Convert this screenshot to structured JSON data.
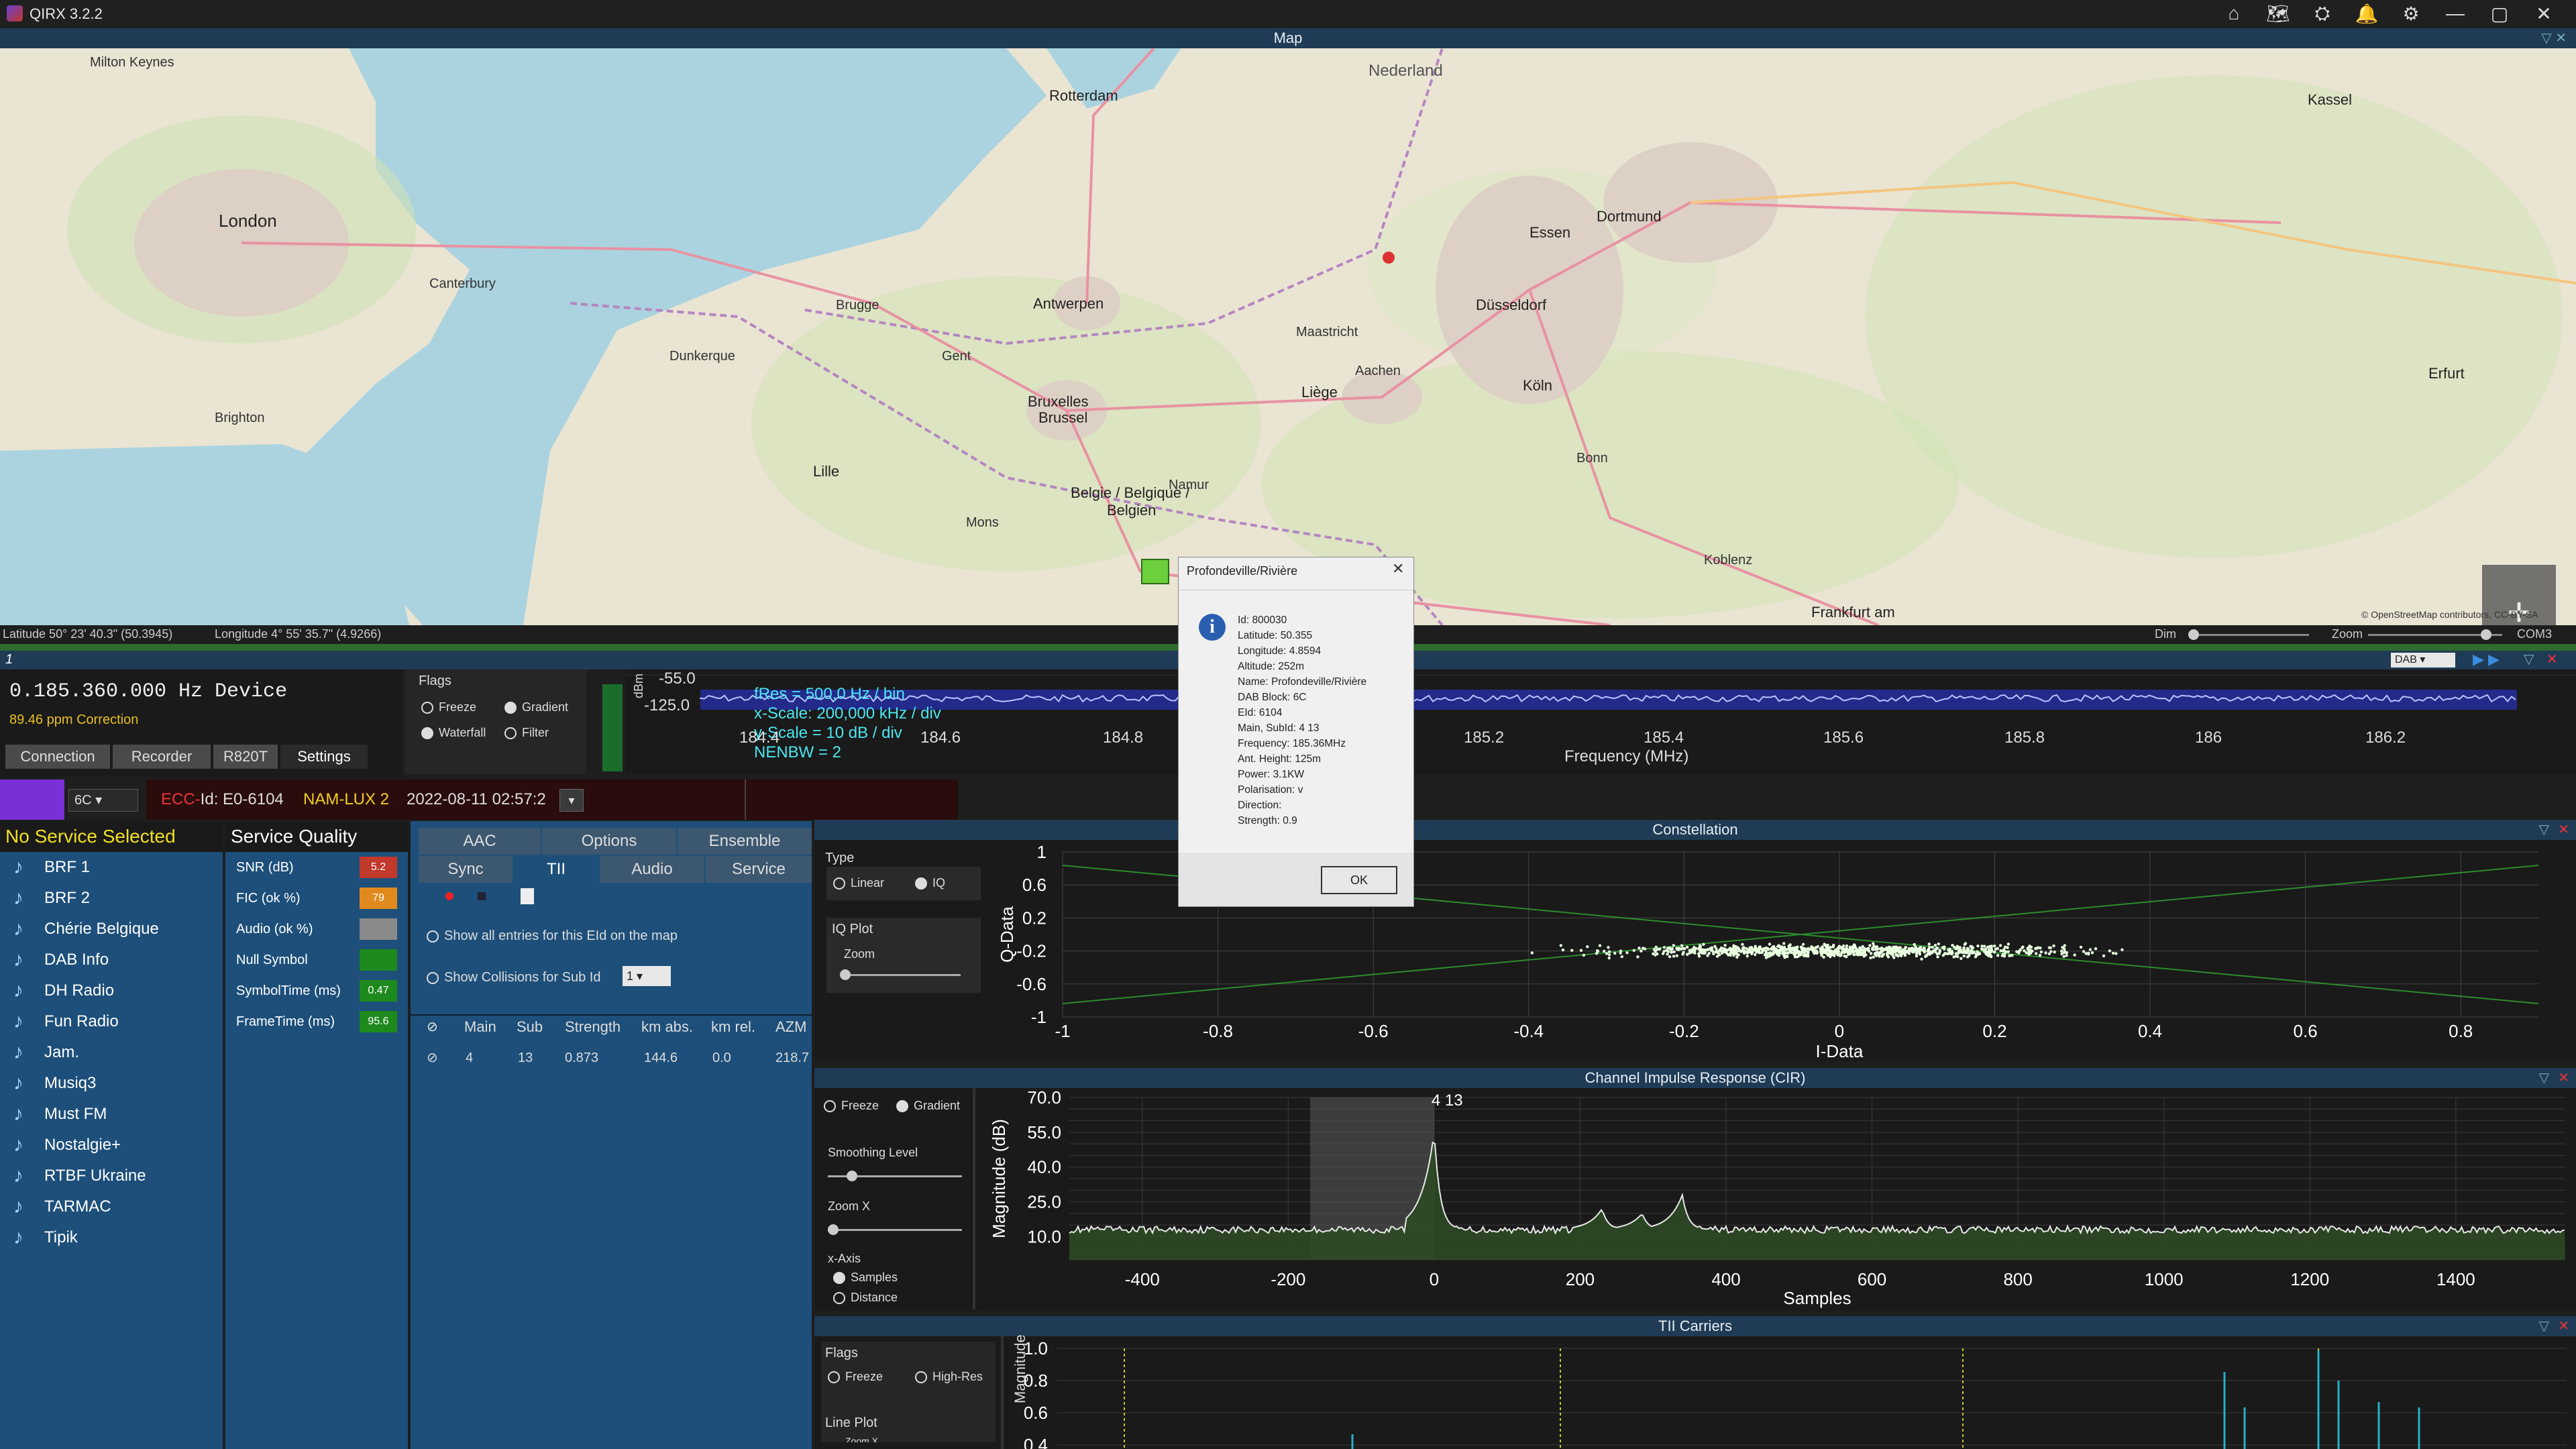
{
  "window": {
    "title": "QIRX 3.2.2",
    "controls": [
      "⌂",
      "🗺",
      "⛭",
      "🔔",
      "⚙",
      "—",
      "▢",
      "✕"
    ]
  },
  "map": {
    "header": "Map",
    "labels": [
      {
        "t": "Milton Keynes"
      },
      {
        "t": "London"
      },
      {
        "t": "Brighton"
      },
      {
        "t": "Rotterdam"
      },
      {
        "t": "Antwerpen"
      },
      {
        "t": "Bruxelles"
      },
      {
        "t": "Brussel"
      },
      {
        "t": "Lille"
      },
      {
        "t": "Düsseldorf"
      },
      {
        "t": "Köln"
      },
      {
        "t": "Dortmund"
      },
      {
        "t": "Essen"
      },
      {
        "t": "Liège"
      },
      {
        "t": "Frankfurt am"
      },
      {
        "t": "Belgie / Belgique /"
      },
      {
        "t": "Belgien"
      },
      {
        "t": "Brugge"
      },
      {
        "t": "Gent"
      },
      {
        "t": "Mons"
      },
      {
        "t": "Namur"
      },
      {
        "t": "Aachen"
      },
      {
        "t": "Bonn"
      },
      {
        "t": "Koblenz"
      },
      {
        "t": "Maastricht"
      },
      {
        "t": "Erfurt"
      },
      {
        "t": "Kassel"
      },
      {
        "t": "Nederland"
      },
      {
        "t": "Canterbury"
      },
      {
        "t": "Dunkerque"
      }
    ],
    "footer_lat": "Latitude  50° 23' 40.3\" (50.3945)",
    "footer_lon": "Longitude  4° 55' 35.7\" (4.9266)",
    "dim_label": "Dim",
    "zoom_label": "Zoom",
    "com_label": "COM3",
    "attribution": "© OpenStreetMap contributors, CC-BY-SA"
  },
  "spectrum": {
    "freq_display": "0.185.360.000 Hz Device",
    "ppm": "89.46 ppm Correction",
    "tabs": [
      "Connection",
      "Recorder",
      "R820T",
      "Settings"
    ],
    "flags_title": "Flags",
    "flags": [
      {
        "label": "Freeze",
        "on": false
      },
      {
        "label": "Gradient",
        "on": true
      },
      {
        "label": "Waterfall",
        "on": true
      },
      {
        "label": "Filter",
        "on": false
      }
    ],
    "mode": "DAB",
    "info_lines": [
      "fRes = 500,0 Hz / bin",
      "x-Scale: 200,000 kHz / div",
      "y-Scale = 10 dB / div",
      "NENBW = 2"
    ],
    "y_top": "-55.0",
    "y_bot": "-125.0",
    "x_ticks": [
      "184.6",
      "184.8",
      "185",
      "185.2",
      "185.4",
      "185.6",
      "185.8",
      "186",
      "186.2"
    ],
    "x_label": "Frequency (MHz)",
    "y_unit": "dBm",
    "num_indicator": "1",
    "left_tick": "184.4"
  },
  "ensemble_bar": {
    "block": "6C",
    "ecc_label": "ECC-EId: E0-6104",
    "ecc_prefix": "ECC-",
    "ecc_rest": "Id: E0-6104",
    "name": "NAM-LUX 2",
    "datetime": "2022-08-11  02:57:2"
  },
  "services": {
    "header": "No Service Selected",
    "items": [
      "BRF 1",
      "BRF 2",
      "Chérie Belgique",
      "DAB Info",
      "DH Radio",
      "Fun Radio",
      "Jam.",
      "Musiq3",
      "Must FM",
      "Nostalgie+",
      "RTBF Ukraine",
      "TARMAC",
      "Tipik"
    ]
  },
  "quality": {
    "header": "Service Quality",
    "rows": [
      {
        "label": "SNR (dB)",
        "value": "5.2",
        "color": "#c0392b"
      },
      {
        "label": "FIC (ok %)",
        "value": "79",
        "color": "#e08a1e"
      },
      {
        "label": "Audio (ok %)",
        "value": "",
        "color": "#8a8a8a"
      },
      {
        "label": "Null Symbol",
        "value": "",
        "color": "#1e8a1e"
      },
      {
        "label": "SymbolTime (ms)",
        "value": "0.47",
        "color": "#1e8a1e"
      },
      {
        "label": "FrameTime (ms)",
        "value": "95.6",
        "color": "#1e8a1e"
      }
    ]
  },
  "tii": {
    "tabs_row1": [
      "AAC",
      "Options",
      "Ensemble"
    ],
    "tabs_row2": [
      "Sync",
      "TII",
      "Audio",
      "Service"
    ],
    "opt1": "Show all entries for this EId on the map",
    "opt2": "Show Collisions for Sub Id",
    "opt2_value": "1",
    "cols": [
      "Main",
      "Sub",
      "Strength",
      "km abs.",
      "km rel.",
      "AZM"
    ],
    "rows": [
      [
        "4",
        "13",
        "0.873",
        "144.6",
        "0.0",
        "218.7"
      ]
    ]
  },
  "constellation": {
    "header": "Constellation",
    "type_title": "Type",
    "type_opts": [
      {
        "label": "Linear",
        "on": false
      },
      {
        "label": "IQ",
        "on": true
      }
    ],
    "iq_title": "IQ Plot",
    "zoom_label": "Zoom",
    "y_ticks": [
      "1",
      "0.6",
      "0.2",
      "-0.2",
      "-0.6",
      "-1"
    ],
    "x_ticks": [
      "-1",
      "-0.8",
      "-0.6",
      "-0.4",
      "-0.2",
      "0",
      "0.2",
      "0.4",
      "0.6",
      "0.8"
    ],
    "xlabel": "I-Data",
    "ylabel": "Q-Data"
  },
  "cir": {
    "header": "Channel Impulse Response (CIR)",
    "flags": [
      {
        "label": "Freeze",
        "on": false
      },
      {
        "label": "Gradient",
        "on": true
      }
    ],
    "smoothing": "Smoothing Level",
    "zoomx": "Zoom X",
    "xaxis_title": "x-Axis",
    "xaxis_opts": [
      {
        "label": "Samples",
        "on": true
      },
      {
        "label": "Distance",
        "on": false
      }
    ],
    "peak_label": "4 13",
    "y_ticks": [
      "70.0",
      "55.0",
      "40.0",
      "25.0",
      "10.0"
    ],
    "x_ticks": [
      "-400",
      "-200",
      "0",
      "200",
      "400",
      "600",
      "800",
      "1000",
      "1200",
      "1400"
    ],
    "xlabel": "Samples",
    "ylabel": "Magnitude (dB)"
  },
  "tii_carriers": {
    "header": "TII Carriers",
    "flags_title": "Flags",
    "flags": [
      {
        "label": "Freeze",
        "on": false
      },
      {
        "label": "High-Res",
        "on": false
      }
    ],
    "line_plot": "Line Plot",
    "zoomx": "Zoom X",
    "y_ticks": [
      "1.0",
      "0.8",
      "0.6",
      "0.4"
    ],
    "ylabel": "Magnitude"
  },
  "dialog": {
    "title": "Profondeville/Rivière",
    "lines": [
      "Id: 800030",
      "Latitude: 50.355",
      "Longitude: 4.8594",
      "Altitude: 252m",
      "Name: Profondeville/Rivière",
      "DAB Block: 6C",
      "EId: 6104",
      "Main, SubId: 4 13",
      "Frequency: 185.36MHz",
      "Ant. Height: 125m",
      "Power: 3.1KW",
      "Polarisation: v",
      "Direction:",
      "Strength: 0.9"
    ],
    "ok": "OK",
    "info_glyph": "i",
    "close_glyph": "✕"
  },
  "chart_data": [
    {
      "type": "scatter",
      "ylabel": "Q-Data",
      "xlabel": "I-Data",
      "xlim": [
        -1,
        0.9
      ],
      "ylim": [
        -1,
        1
      ],
      "center": [
        0,
        -0.2
      ]
    },
    {
      "type": "line",
      "xlabel": "Samples",
      "ylabel": "Magnitude (dB)",
      "xlim": [
        -500,
        1550
      ],
      "ylim": [
        0,
        70
      ],
      "noise_floor": 13,
      "peaks": [
        {
          "x": 0,
          "y": 55
        },
        {
          "x": 230,
          "y": 22
        },
        {
          "x": 285,
          "y": 20
        },
        {
          "x": 340,
          "y": 28
        }
      ],
      "shaded_range": [
        -170,
        0
      ]
    }
  ]
}
